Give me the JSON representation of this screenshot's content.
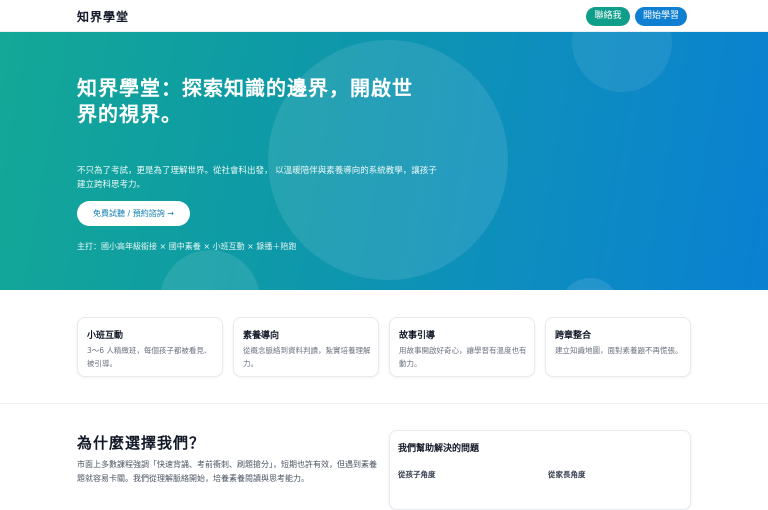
{
  "header": {
    "brand": "知界學堂",
    "contact_label": "聯絡我",
    "start_label": "開始學習"
  },
  "hero": {
    "title": "知界學堂：探索知識的邊界，開啟世界的視界。",
    "description": "不只為了考試，更是為了理解世界。從社會科出發， 以溫暖陪伴與素養導向的系統教學，讓孩子建立跨科思考力。",
    "cta_label": "免費試聽 / 預約諮詢 →",
    "subline": "主打：國小高年級銜接 × 國中素養 × 小班互動 × 錄播＋陪跑"
  },
  "features": [
    {
      "title": "小班互動",
      "text": "3～6 人精緻班，每個孩子都被看見、被引導。"
    },
    {
      "title": "素養導向",
      "text": "從概念脈絡到資料判讀，紮實培養理解力。"
    },
    {
      "title": "故事引導",
      "text": "用故事開啟好奇心，讓學習有溫度也有動力。"
    },
    {
      "title": "跨章整合",
      "text": "建立知識地圖，面對素養題不再慌張。"
    }
  ],
  "why": {
    "title": "為什麼選擇我們？",
    "text": "市面上多數課程強調「快速背誦、考前衝刺、刷題搶分」，短期也許有效，但遇到素養題就容易卡關。我們從理解脈絡開始，培養素養閱讀與思考能力。"
  },
  "problems": {
    "title": "我們幫助解決的問題",
    "child_view": "從孩子角度",
    "parent_view": "從家長角度"
  }
}
